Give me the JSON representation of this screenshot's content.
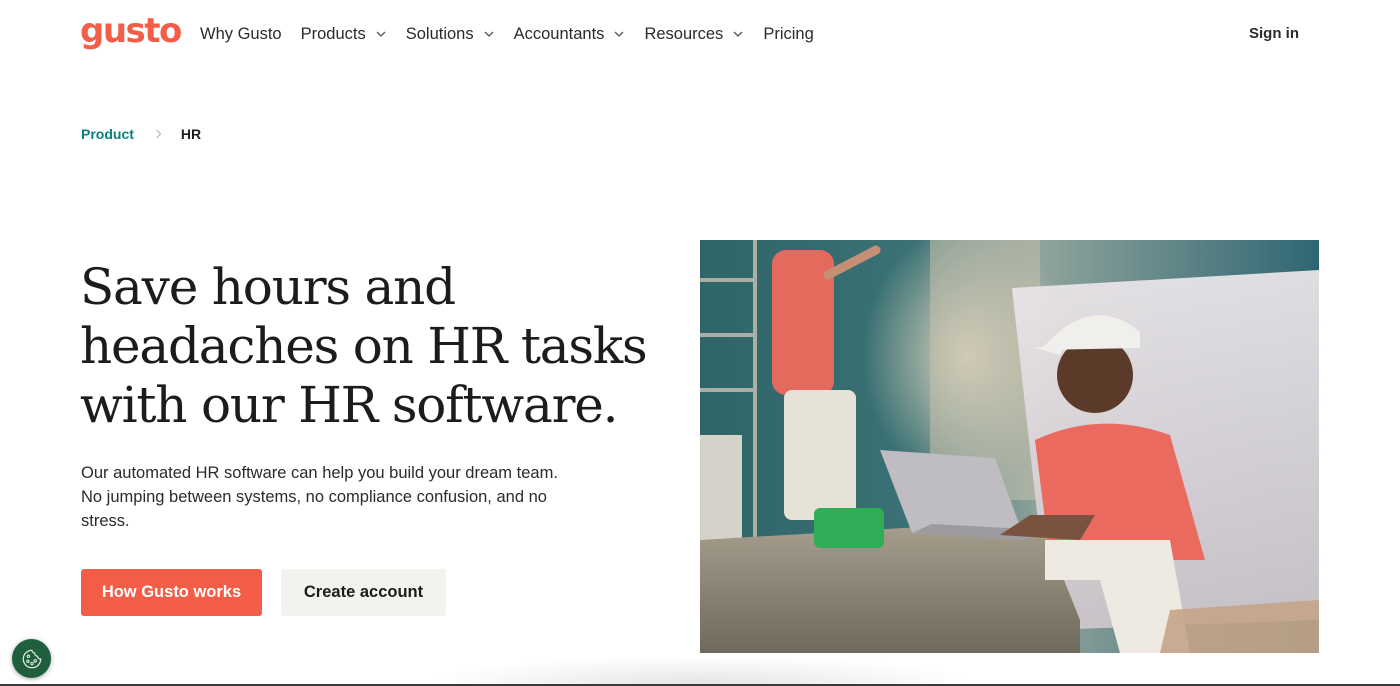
{
  "brand": {
    "logo_text": "gusto",
    "accent_color": "#f45d48",
    "link_color": "#0a8080"
  },
  "header": {
    "nav": [
      {
        "label": "Why Gusto",
        "has_dropdown": false
      },
      {
        "label": "Products",
        "has_dropdown": true
      },
      {
        "label": "Solutions",
        "has_dropdown": true
      },
      {
        "label": "Accountants",
        "has_dropdown": true
      },
      {
        "label": "Resources",
        "has_dropdown": true
      },
      {
        "label": "Pricing",
        "has_dropdown": false
      }
    ],
    "sign_in_label": "Sign in"
  },
  "breadcrumb": {
    "items": [
      {
        "label": "Product",
        "link": true
      },
      {
        "label": "HR",
        "link": false
      }
    ],
    "separator_icon": "chevron-right-icon"
  },
  "hero": {
    "title_lines": [
      "Save hours and",
      "headaches on HR tasks",
      "with our HR software."
    ],
    "description_lines": [
      "Our automated HR software can help you build your dream team.",
      "No jumping between systems, no compliance confusion, and no",
      "stress."
    ],
    "primary_button": "How Gusto works",
    "secondary_button": "Create account",
    "image_alt": "Painter in a red t-shirt and white cap working on a laptop at a job site"
  },
  "cookie_button": {
    "icon": "cookie-icon"
  }
}
